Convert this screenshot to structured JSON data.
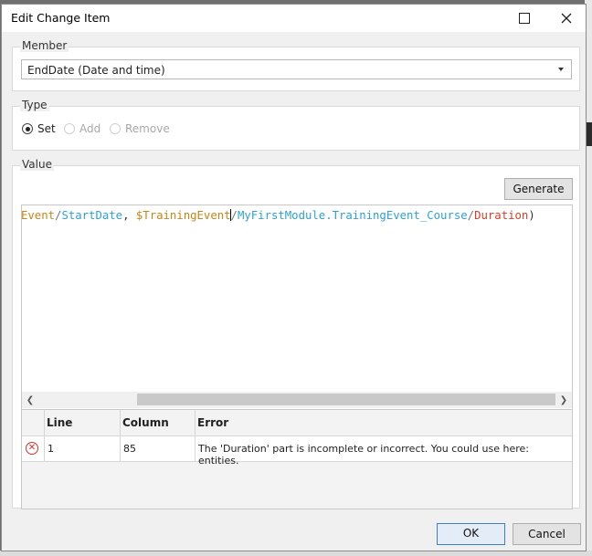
{
  "dialog": {
    "title": "Edit Change Item",
    "maximize_icon": "maximize-icon",
    "close_icon": "close-icon"
  },
  "member": {
    "legend": "Member",
    "selected": "EndDate (Date and time)"
  },
  "type": {
    "legend": "Type",
    "options": [
      {
        "label": "Set",
        "checked": true,
        "enabled": true
      },
      {
        "label": "Add",
        "checked": false,
        "enabled": false
      },
      {
        "label": "Remove",
        "checked": false,
        "enabled": false
      }
    ]
  },
  "value": {
    "legend": "Value",
    "generate_label": "Generate",
    "code_tokens": [
      {
        "text": "Event",
        "kind": "attr"
      },
      {
        "text": "/",
        "kind": "slash"
      },
      {
        "text": "StartDate",
        "kind": "blue"
      },
      {
        "text": ", ",
        "kind": "plain"
      },
      {
        "text": "$TrainingEvent",
        "kind": "var"
      },
      {
        "text": "/",
        "kind": "slash"
      },
      {
        "text": "MyFirstModule.TrainingEvent_Course",
        "kind": "blue"
      },
      {
        "text": "/",
        "kind": "slash"
      },
      {
        "text": "Duration",
        "kind": "red"
      },
      {
        "text": ")",
        "kind": "plain"
      }
    ]
  },
  "errors": {
    "columns": [
      "Line",
      "Column",
      "Error"
    ],
    "rows": [
      {
        "line": "1",
        "column": "85",
        "error": "The 'Duration' part is incomplete or incorrect. You could use here: entities."
      }
    ]
  },
  "footer": {
    "ok_label": "OK",
    "cancel_label": "Cancel"
  },
  "colors": {
    "accent": "#3d7fce",
    "error": "#d9302c"
  }
}
